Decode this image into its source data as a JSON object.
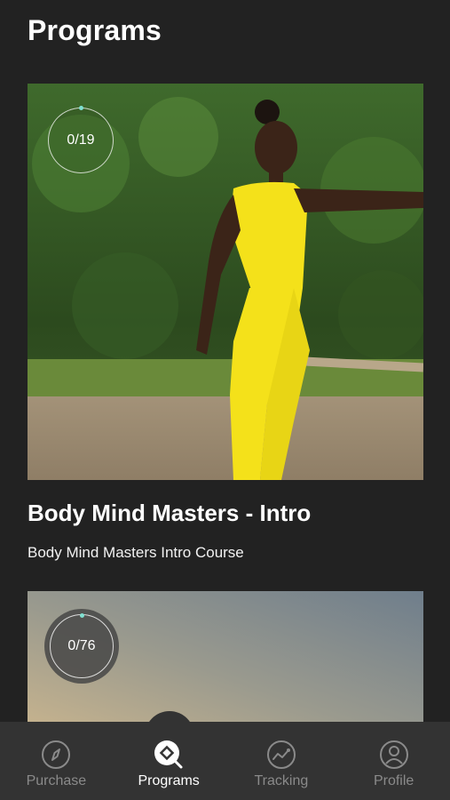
{
  "header": {
    "title": "Programs"
  },
  "programs": [
    {
      "progress": "0/19",
      "title": "Body Mind Masters - Intro",
      "subtitle": "Body Mind Masters Intro Course"
    },
    {
      "progress": "0/76"
    }
  ],
  "nav": {
    "items": [
      {
        "label": "Purchase",
        "icon": "compass-icon",
        "active": false
      },
      {
        "label": "Programs",
        "icon": "programs-icon",
        "active": true
      },
      {
        "label": "Tracking",
        "icon": "tracking-icon",
        "active": false
      },
      {
        "label": "Profile",
        "icon": "profile-icon",
        "active": false
      }
    ]
  },
  "colors": {
    "background": "#222222",
    "nav": "#333333",
    "active": "#ffffff",
    "inactive": "#8a8a8a",
    "accent": "#7fe0d0"
  }
}
